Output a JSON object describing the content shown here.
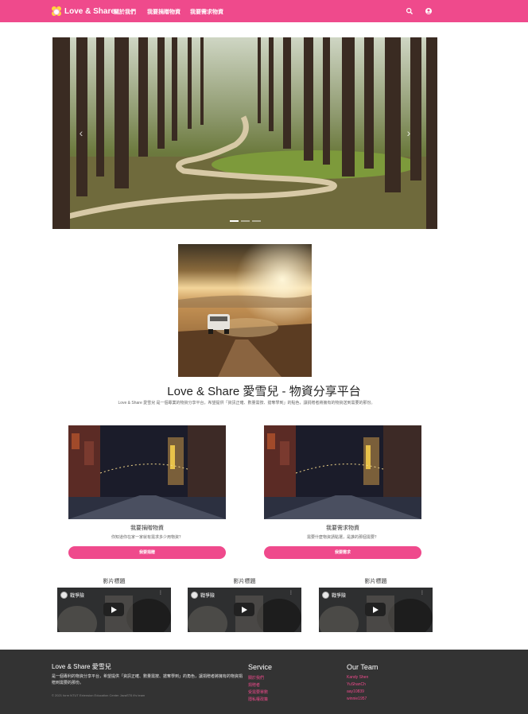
{
  "navbar": {
    "brand": "Love & Share",
    "links": [
      "關於我們",
      "我要捐贈物資",
      "我要需求物資"
    ],
    "icons": [
      "search-icon",
      "user-icon"
    ]
  },
  "carousel": {
    "slide_count": 3,
    "active_index": 0
  },
  "headline": "Love & Share 愛雪兒 - 物資分享平台",
  "intro": "Love & Share 愛雪兒 是一個專業的物資分享平台，希望提供「資訊正確、數量需按、搶奪學到」的點色，讓捐贈者將擁有的物資送到需要的那份。",
  "cards": [
    {
      "title": "我要捐贈物資",
      "desc": "你知道你在家一家就有需求多少用物資？",
      "button": "我要捐贈"
    },
    {
      "title": "我要需求物資",
      "desc": "需要什麼物資請點選，是誰的那個需要？",
      "button": "我要需求"
    }
  ],
  "videos": [
    {
      "title": "影片標題",
      "channel": "戰爭險"
    },
    {
      "title": "影片標題",
      "channel": "戰爭險"
    },
    {
      "title": "影片標題",
      "channel": "戰爭險"
    }
  ],
  "footer": {
    "brand": "Love & Share 愛雪兒",
    "desc": "是一個專利的物資分享平台，希望提供「資訊正確、數量需按、搶奪學到」的角色，讓捐贈者將擁有的物資捐贈到需要的那份。",
    "copyright": "© 2021 form NTUT Extension Education Center JavaST6 it's team",
    "service_title": "Service",
    "service_links": [
      "關於我們",
      "捐贈者",
      "受需要單數",
      "隱私權政策"
    ],
    "team_title": "Our Team",
    "team_members": [
      "Kandy Shen",
      "YuShanCh",
      "aay10839",
      "winnie1957"
    ]
  },
  "colors": {
    "accent": "#ef4a8c",
    "footer_bg": "#333333"
  }
}
